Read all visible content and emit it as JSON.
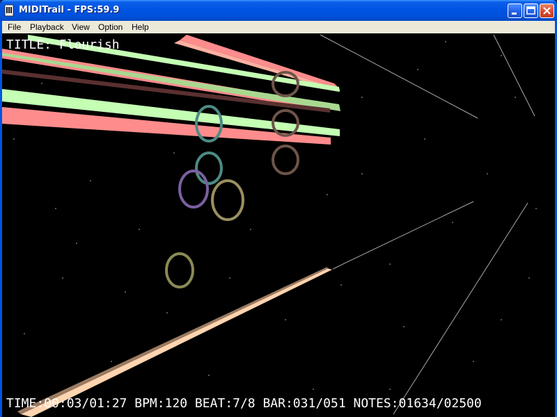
{
  "window": {
    "title": "MIDITrail - FPS:59.9"
  },
  "menu": {
    "items": [
      "File",
      "Playback",
      "View",
      "Option",
      "Help"
    ]
  },
  "overlay": {
    "title_line": "TITLE: Flourish",
    "status_line": "TIME:00:03/01:27 BPM:120 BEAT:7/8 BAR:031/051 NOTES:01634/02500"
  },
  "icons": {
    "app": "midi-note-document-icon",
    "minimize": "minimize-icon",
    "maximize": "maximize-icon",
    "close": "close-icon"
  },
  "colors": {
    "titlebar": "#0054e3",
    "menubar": "#ece9d8",
    "scene_background": "#000000",
    "note_bar_pink": "#ff8c8c",
    "note_bar_green": "#c4ffb4",
    "note_bar_peach": "#ffd4b0"
  }
}
